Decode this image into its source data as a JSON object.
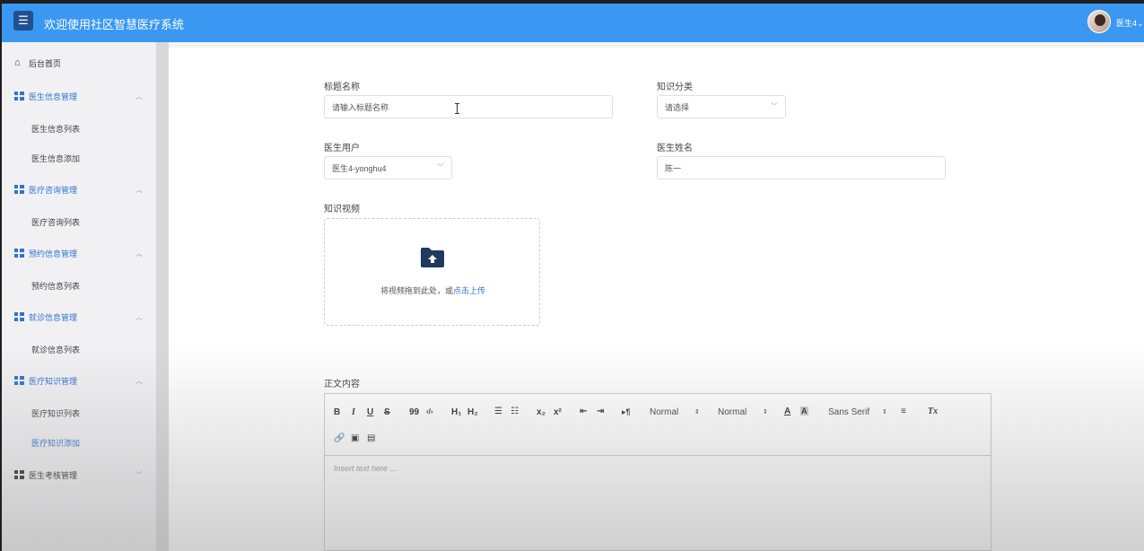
{
  "header": {
    "menu_icon": "menu-icon",
    "title": "欢迎使用社区智慧医疗系统",
    "user_name": "医生4",
    "user_caret": "⌄"
  },
  "sidebar": {
    "home": "后台首页",
    "groups": [
      {
        "label": "医生信息管理",
        "items": [
          "医生信息列表",
          "医生信息添加"
        ]
      },
      {
        "label": "医疗咨询管理",
        "items": [
          "医疗咨询列表"
        ]
      },
      {
        "label": "预约信息管理",
        "items": [
          "预约信息列表"
        ]
      },
      {
        "label": "就诊信息管理",
        "items": [
          "就诊信息列表"
        ]
      },
      {
        "label": "医疗知识管理",
        "items": [
          "医疗知识列表",
          "医疗知识添加"
        ]
      },
      {
        "label": "医生考核管理",
        "items": []
      }
    ],
    "active_item": "医疗知识添加"
  },
  "form": {
    "title_label": "标题名称",
    "title_placeholder": "请输入标题名称",
    "category_label": "知识分类",
    "category_value": "请选择",
    "user_label": "医生用户",
    "user_value": "医生4-yonghu4",
    "name_label": "医生姓名",
    "name_value": "陈一",
    "video_label": "知识视频",
    "upload_text": "将视频拖到此处，或",
    "upload_link": "点击上传",
    "content_label": "正文内容"
  },
  "editor": {
    "bold": "B",
    "italic": "I",
    "underline": "U",
    "strike": "S",
    "quote": "99",
    "code": "‹/›",
    "h1": "H₁",
    "h2": "H₂",
    "sub": "x₂",
    "sup": "x²",
    "rtl": "▸¶",
    "size": "Normal",
    "header": "Normal",
    "font": "Sans Serif",
    "clean": "Tx",
    "placeholder": "Insert text here ..."
  }
}
